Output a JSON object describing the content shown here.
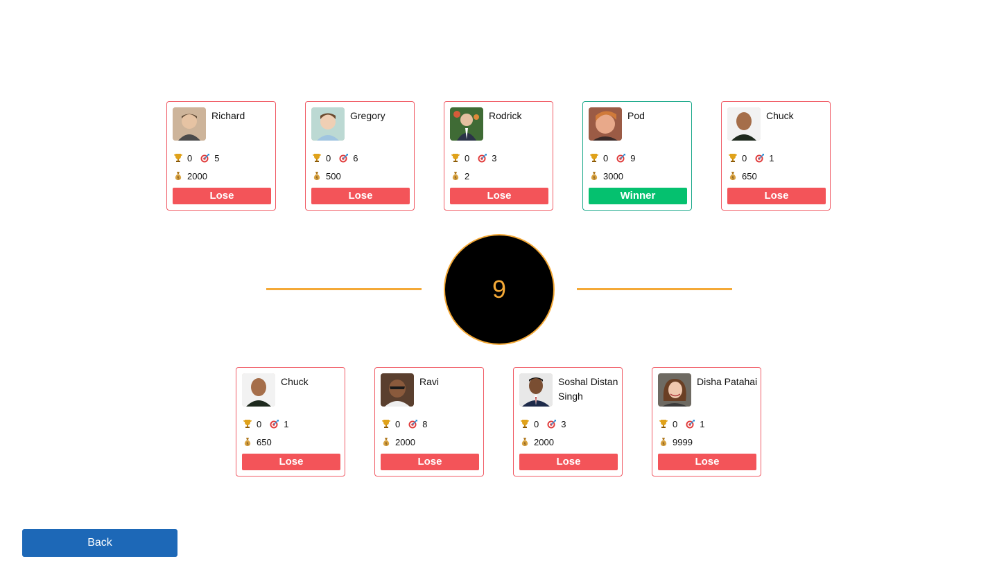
{
  "players_top": [
    {
      "name": "Richard",
      "trophies": "0",
      "hits": "5",
      "money": "2000",
      "status": "Lose",
      "avatar_color": "#cdb49a"
    },
    {
      "name": "Gregory",
      "trophies": "0",
      "hits": "6",
      "money": "500",
      "status": "Lose",
      "avatar_color": "#bcd9d3"
    },
    {
      "name": "Rodrick",
      "trophies": "0",
      "hits": "3",
      "money": "2",
      "status": "Lose",
      "avatar_color": "#3f6b35"
    },
    {
      "name": "Pod",
      "trophies": "0",
      "hits": "9",
      "money": "3000",
      "status": "Winner",
      "avatar_color": "#9b5b45"
    },
    {
      "name": "Chuck",
      "trophies": "0",
      "hits": "1",
      "money": "650",
      "status": "Lose",
      "avatar_color": "#f2f2f2"
    }
  ],
  "players_bottom": [
    {
      "name": "Chuck",
      "trophies": "0",
      "hits": "1",
      "money": "650",
      "status": "Lose",
      "avatar_color": "#f2f2f2"
    },
    {
      "name": "Ravi",
      "trophies": "0",
      "hits": "8",
      "money": "2000",
      "status": "Lose",
      "avatar_color": "#5a3f2e"
    },
    {
      "name": "Soshal Distan Singh",
      "trophies": "0",
      "hits": "3",
      "money": "2000",
      "status": "Lose",
      "avatar_color": "#e8e8e8"
    },
    {
      "name": "Disha Patahai",
      "trophies": "0",
      "hits": "1",
      "money": "9999",
      "status": "Lose",
      "avatar_color": "#6e6a62"
    }
  ],
  "timer": {
    "value": "9"
  },
  "back_label": "Back",
  "icons": {
    "trophy": "trophy-icon",
    "target": "target-icon",
    "money": "money-bag-icon"
  },
  "colors": {
    "lose": "#f35459",
    "winner": "#05c16f",
    "accent": "#f4a937",
    "back": "#1d68b7"
  }
}
